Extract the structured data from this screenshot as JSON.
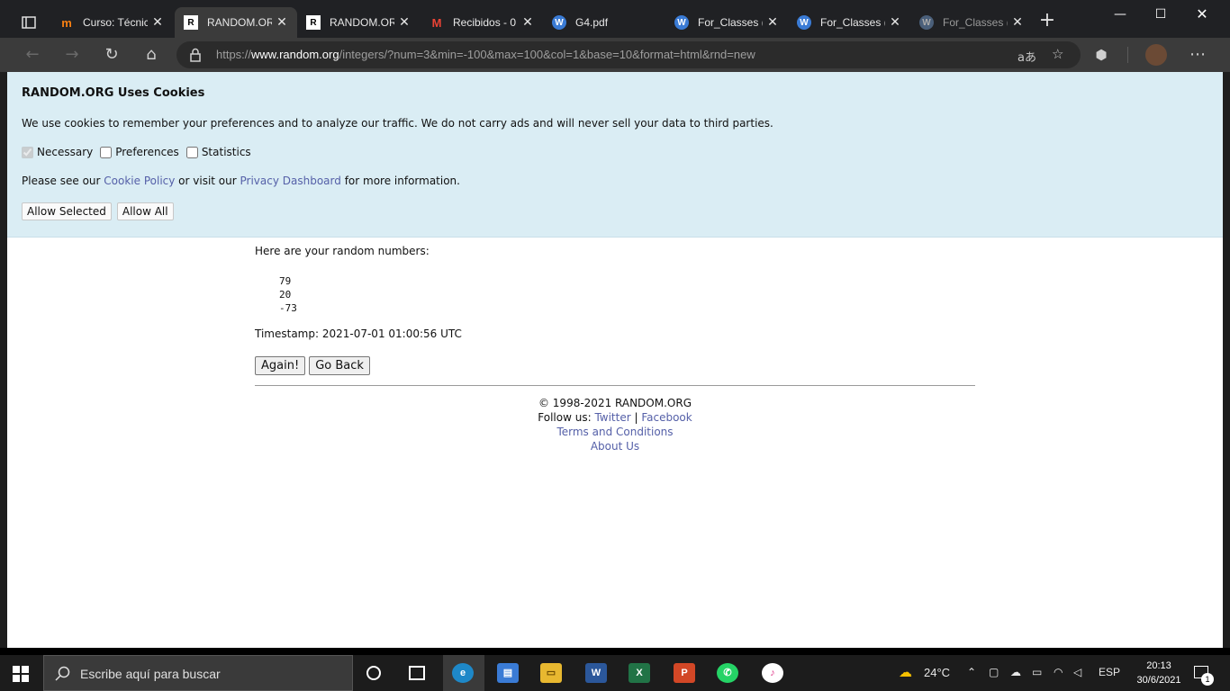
{
  "browser": {
    "tabs": [
      {
        "label": "Curso: Técnic",
        "favicon": "moodle-icon"
      },
      {
        "label": "RANDOM.OR",
        "favicon": "random-org-icon",
        "active": true
      },
      {
        "label": "RANDOM.OR",
        "favicon": "random-org-icon"
      },
      {
        "label": "Recibidos - 0",
        "favicon": "gmail-icon"
      },
      {
        "label": "G4.pdf",
        "favicon": "wordpress-icon"
      },
      {
        "label": "For_Classes (",
        "favicon": "wordpress-icon"
      },
      {
        "label": "For_Classes (",
        "favicon": "wordpress-icon"
      },
      {
        "label": "For_Classes (",
        "favicon": "wordpress-icon"
      }
    ],
    "url_scheme": "https://",
    "url_host": "www.random.org",
    "url_path": "/integers/?num=3&min=-100&max=100&col=1&base=10&format=html&rnd=new",
    "read_aloud": "aあ"
  },
  "cookie_banner": {
    "title": "RANDOM.ORG Uses Cookies",
    "text": "We use cookies to remember your preferences and to analyze our traffic. We do not carry ads and will never sell your data to third parties.",
    "checkboxes": [
      {
        "label": "Necessary",
        "checked": true,
        "disabled": true
      },
      {
        "label": "Preferences",
        "checked": false
      },
      {
        "label": "Statistics",
        "checked": false
      }
    ],
    "see_prefix": "Please see our ",
    "cookie_policy": "Cookie Policy",
    "see_middle": " or visit our ",
    "privacy_dashboard": "Privacy Dashboard",
    "see_suffix": " for more information.",
    "allow_selected": "Allow Selected",
    "allow_all": "Allow All"
  },
  "result": {
    "intro": "Here are your random numbers:",
    "numbers": [
      "79",
      "20",
      "-73"
    ],
    "timestamp": "Timestamp: 2021-07-01 01:00:56 UTC",
    "again": "Again!",
    "go_back": "Go Back"
  },
  "footer": {
    "copyright": "© 1998-2021 RANDOM.ORG",
    "follow": "Follow us: ",
    "twitter": "Twitter",
    "divider": " | ",
    "facebook": "Facebook",
    "terms": "Terms and Conditions",
    "about": "About Us"
  },
  "taskbar": {
    "search_placeholder": "Escribe aquí para buscar",
    "weather": "24°C",
    "language": "ESP",
    "time": "20:13",
    "date": "30/6/2021",
    "notifications": "1"
  }
}
